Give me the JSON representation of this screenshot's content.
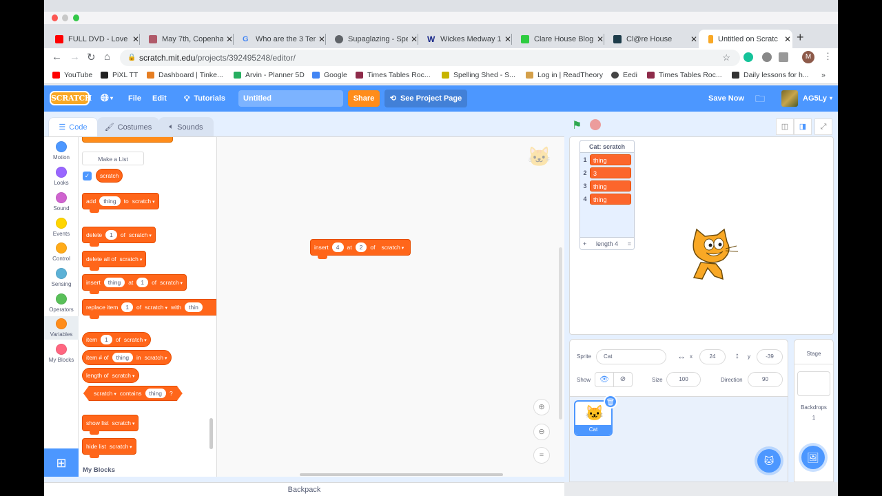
{
  "browser": {
    "tabs": [
      {
        "title": "FULL DVD - Love",
        "icon": "youtube-icon",
        "color": "#ff0000"
      },
      {
        "title": "May 7th, Copenha",
        "icon": "photo-icon",
        "color": "#b05a6a"
      },
      {
        "title": "Who are the 3 Ter",
        "icon": "google-icon",
        "color": "#4285f4"
      },
      {
        "title": "Supaglazing - Spe",
        "icon": "globe-icon",
        "color": "#5f6368"
      },
      {
        "title": "Wickes Medway 1",
        "icon": "wickes-icon",
        "color": "#1b2a8a"
      },
      {
        "title": "Clare House Blog",
        "icon": "sites-icon",
        "color": "#2ecc40"
      },
      {
        "title": "Cl@re House",
        "icon": "app-icon",
        "color": "#1d3c4a"
      },
      {
        "title": "Untitled on Scratc",
        "icon": "scratch-icon",
        "color": "#f9a825",
        "active": true
      }
    ],
    "url_host": "scratch.mit.edu",
    "url_path": "/projects/392495248/editor/",
    "profile_initial": "M",
    "bookmarks": [
      {
        "label": "YouTube",
        "color": "#ff0000"
      },
      {
        "label": "PiXL TT",
        "color": "#222222"
      },
      {
        "label": "Dashboard | Tinke...",
        "color": "#e67e22"
      },
      {
        "label": "Arvin - Planner 5D",
        "color": "#27ae60"
      },
      {
        "label": "Google",
        "color": "#4285f4"
      },
      {
        "label": "Times Tables Roc...",
        "color": "#8e2b4a"
      },
      {
        "label": "Spelling Shed - S...",
        "color": "#c7b400"
      },
      {
        "label": "Log in | ReadTheory",
        "color": "#d4a04a"
      },
      {
        "label": "Eedi",
        "color": "#444444"
      },
      {
        "label": "Times Tables Roc...",
        "color": "#8e2b4a"
      },
      {
        "label": "Daily lessons for h...",
        "color": "#333333"
      }
    ],
    "bookmarks_overflow": "»"
  },
  "scratch": {
    "logo": "SCRATCH",
    "menu": {
      "file": "File",
      "edit": "Edit",
      "tutorials": "Tutorials",
      "share": "Share",
      "see_project": "See Project Page",
      "save_now": "Save Now",
      "username": "AG5Ly"
    },
    "project_title": "Untitled",
    "editor_tabs": {
      "code": "Code",
      "costumes": "Costumes",
      "sounds": "Sounds"
    },
    "categories": [
      {
        "label": "Motion",
        "color": "#4c97ff"
      },
      {
        "label": "Looks",
        "color": "#9966ff"
      },
      {
        "label": "Sound",
        "color": "#cf63cf"
      },
      {
        "label": "Events",
        "color": "#ffd500"
      },
      {
        "label": "Control",
        "color": "#ffab19"
      },
      {
        "label": "Sensing",
        "color": "#5cb1d6"
      },
      {
        "label": "Operators",
        "color": "#59c059"
      },
      {
        "label": "Variables",
        "color": "#ff8c1a"
      },
      {
        "label": "My Blocks",
        "color": "#ff6680"
      }
    ],
    "palette": {
      "make_list": "Make a List",
      "list_name": "scratch",
      "blocks": {
        "add": {
          "t1": "add",
          "v1": "thing",
          "t2": "to",
          "dd": "scratch"
        },
        "delete": {
          "t1": "delete",
          "v1": "1",
          "t2": "of",
          "dd": "scratch"
        },
        "delete_all": {
          "t1": "delete all of",
          "dd": "scratch"
        },
        "insert": {
          "t1": "insert",
          "v1": "thing",
          "t2": "at",
          "v2": "1",
          "t3": "of",
          "dd": "scratch"
        },
        "replace": {
          "t1": "replace item",
          "v1": "1",
          "t2": "of",
          "dd": "scratch",
          "t3": "with",
          "v2": "thin"
        },
        "item": {
          "t1": "item",
          "v1": "1",
          "t2": "of",
          "dd": "scratch"
        },
        "item_num": {
          "t1": "item # of",
          "v1": "thing",
          "t2": "in",
          "dd": "scratch"
        },
        "length": {
          "t1": "length of",
          "dd": "scratch"
        },
        "contains": {
          "dd": "scratch",
          "t1": "contains",
          "v1": "thing",
          "t2": "?"
        },
        "show": {
          "t1": "show list",
          "dd": "scratch"
        },
        "hide": {
          "t1": "hide list",
          "dd": "scratch"
        }
      },
      "my_blocks_heading": "My Blocks"
    },
    "script_block": {
      "t1": "insert",
      "v1": "4",
      "t2": "at",
      "v2": "2",
      "t3": "of",
      "dd": "scratch"
    },
    "backpack": "Backpack",
    "list_monitor": {
      "title": "Cat: scratch",
      "items": [
        "thing",
        "3",
        "thing",
        "thing"
      ],
      "footer_add": "+",
      "length_label": "length 4",
      "footer_resize": "="
    },
    "sprite_info": {
      "sprite_label": "Sprite",
      "sprite_name": "Cat",
      "x_label": "x",
      "x": "24",
      "y_label": "y",
      "y": "-39",
      "show_label": "Show",
      "size_label": "Size",
      "size": "100",
      "direction_label": "Direction",
      "direction": "90"
    },
    "sprites": [
      {
        "name": "Cat"
      }
    ],
    "stage_panel": {
      "title": "Stage",
      "backdrops_label": "Backdrops",
      "backdrops_count": "1"
    }
  }
}
